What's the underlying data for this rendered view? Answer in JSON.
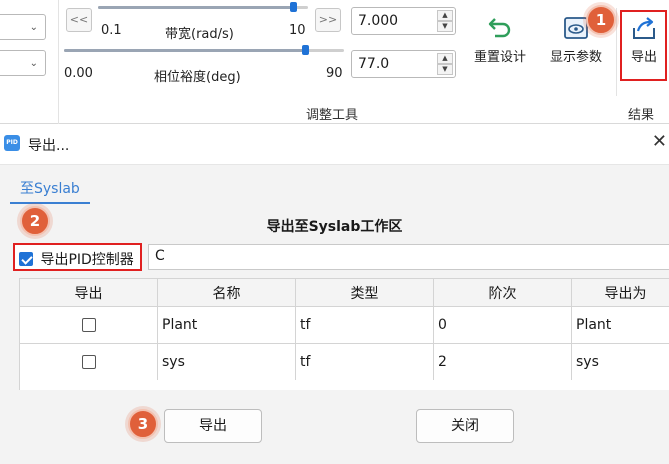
{
  "ribbon": {
    "bandwidth": {
      "min": "0.1",
      "label": "带宽(rad/s)",
      "max": "10",
      "value": "7.000",
      "fill_fraction": 0.93
    },
    "phase_margin": {
      "min": "0.00",
      "label": "相位裕度(deg)",
      "max": "90",
      "value": "77.0",
      "fill_fraction": 0.86
    },
    "nav_prev": "<<",
    "nav_next": ">>",
    "reset_design_label": "重置设计",
    "show_params_label": "显示参数",
    "export_label": "导出",
    "tune_group_label": "调整工具",
    "result_group_label": "结果"
  },
  "dialog": {
    "title": "导出...",
    "icon_text": "PID",
    "tab_label": "至Syslab",
    "section_title": "导出至Syslab工作区",
    "export_pid_label": "导出PID控制器",
    "export_pid_checked": true,
    "controller_name": "C",
    "table": {
      "headers": [
        "导出",
        "名称",
        "类型",
        "阶次",
        "导出为"
      ],
      "rows": [
        {
          "checked": false,
          "name": "Plant",
          "type": "tf",
          "order": "0",
          "export_as": "Plant"
        },
        {
          "checked": false,
          "name": "sys",
          "type": "tf",
          "order": "2",
          "export_as": "sys"
        }
      ]
    },
    "export_button": "导出",
    "close_button": "关闭"
  },
  "badges": [
    "1",
    "2",
    "3"
  ],
  "colors": {
    "accent": "#1f72d6",
    "badge": "#e0603a",
    "highlight": "#e02020",
    "tab": "#3a7fd2"
  }
}
